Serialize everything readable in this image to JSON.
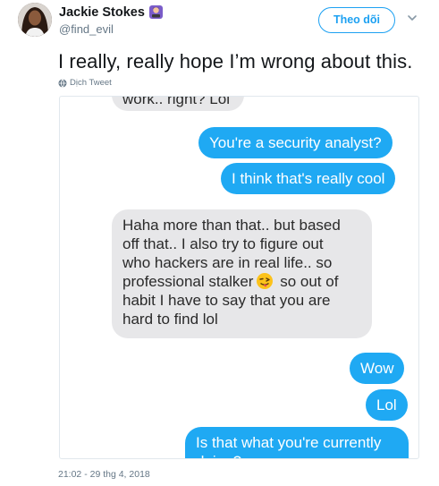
{
  "author": {
    "display_name": "Jackie Stokes",
    "handle": "@find_evil",
    "avatar_icon": "profile-photo",
    "name_badge_icon": "woman-technologist-emoji"
  },
  "actions": {
    "follow_label": "Theo dõi",
    "menu_icon": "chevron-down-icon"
  },
  "tweet": {
    "text": "I really, really hope I’m wrong about this.",
    "translate_label": "Dịch Tweet",
    "timestamp": "21:02 - 29 thg 4, 2018"
  },
  "conversation": {
    "messages": [
      {
        "side": "received",
        "text": "work.. right? Lol"
      },
      {
        "side": "sent",
        "text": "You're a security analyst?"
      },
      {
        "side": "sent",
        "text": "I think that's really cool"
      },
      {
        "side": "received",
        "lines": [
          "Haha more than that.. but based",
          "off that.. I also try to figure out",
          "who hackers are in real life.. so",
          "professional stalker",
          "so out of",
          "habit I have to say that you are",
          "hard to find lol"
        ],
        "emoji_icon": "winking-face-tongue-emoji"
      },
      {
        "side": "sent",
        "text": "Wow"
      },
      {
        "side": "sent",
        "text": "Lol"
      },
      {
        "side": "sent",
        "lines": [
          "Is that what you're currently",
          "doing?"
        ]
      }
    ]
  },
  "colors": {
    "twitter_blue": "#1da1f2",
    "sent_bubble": "#1fa9f3",
    "received_bubble": "#e7e7e9",
    "muted_text": "#657786"
  }
}
